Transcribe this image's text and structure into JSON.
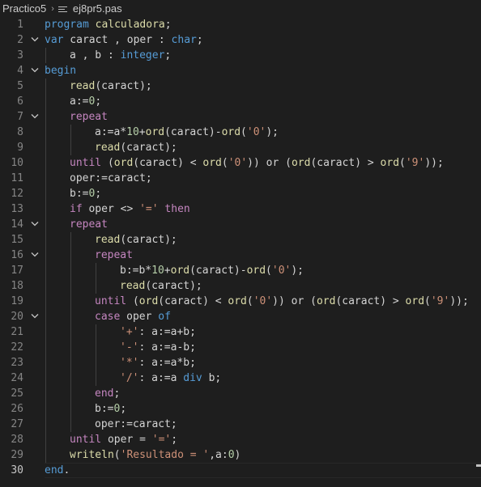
{
  "breadcrumb": {
    "folder": "Practico5",
    "separator": "›",
    "file": "ej8pr5.pas"
  },
  "editor": {
    "language": "pascal",
    "current_line": 30,
    "lines": [
      {
        "n": "1",
        "indent": 0,
        "fold": false,
        "tokens": [
          [
            "kw",
            "program"
          ],
          [
            "tx",
            " "
          ],
          [
            "fn",
            "calculadora"
          ],
          [
            "tx",
            ";"
          ]
        ]
      },
      {
        "n": "2",
        "indent": 0,
        "fold": true,
        "tokens": [
          [
            "kw",
            "var"
          ],
          [
            "tx",
            " caract , oper : "
          ],
          [
            "kw",
            "char"
          ],
          [
            "tx",
            ";"
          ]
        ]
      },
      {
        "n": "3",
        "indent": 1,
        "fold": false,
        "tokens": [
          [
            "tx",
            "a , b : "
          ],
          [
            "kw",
            "integer"
          ],
          [
            "tx",
            ";"
          ]
        ]
      },
      {
        "n": "4",
        "indent": 0,
        "fold": true,
        "tokens": [
          [
            "kw",
            "begin"
          ]
        ]
      },
      {
        "n": "5",
        "indent": 1,
        "fold": false,
        "tokens": [
          [
            "fn",
            "read"
          ],
          [
            "tx",
            "(caract);"
          ]
        ]
      },
      {
        "n": "6",
        "indent": 1,
        "fold": false,
        "tokens": [
          [
            "tx",
            "a:="
          ],
          [
            "num",
            "0"
          ],
          [
            "tx",
            ";"
          ]
        ]
      },
      {
        "n": "7",
        "indent": 1,
        "fold": true,
        "tokens": [
          [
            "ctl",
            "repeat"
          ]
        ]
      },
      {
        "n": "8",
        "indent": 2,
        "fold": false,
        "tokens": [
          [
            "tx",
            "a:=a*"
          ],
          [
            "num",
            "10"
          ],
          [
            "tx",
            "+"
          ],
          [
            "fn",
            "ord"
          ],
          [
            "tx",
            "(caract)-"
          ],
          [
            "fn",
            "ord"
          ],
          [
            "tx",
            "("
          ],
          [
            "str",
            "'0'"
          ],
          [
            "tx",
            ");"
          ]
        ]
      },
      {
        "n": "9",
        "indent": 2,
        "fold": false,
        "tokens": [
          [
            "fn",
            "read"
          ],
          [
            "tx",
            "(caract);"
          ]
        ]
      },
      {
        "n": "10",
        "indent": 1,
        "fold": false,
        "tokens": [
          [
            "ctl",
            "until"
          ],
          [
            "tx",
            " ("
          ],
          [
            "fn",
            "ord"
          ],
          [
            "tx",
            "(caract) < "
          ],
          [
            "fn",
            "ord"
          ],
          [
            "tx",
            "("
          ],
          [
            "str",
            "'0'"
          ],
          [
            "tx",
            ")) or ("
          ],
          [
            "fn",
            "ord"
          ],
          [
            "tx",
            "(caract) > "
          ],
          [
            "fn",
            "ord"
          ],
          [
            "tx",
            "("
          ],
          [
            "str",
            "'9'"
          ],
          [
            "tx",
            "));"
          ]
        ]
      },
      {
        "n": "11",
        "indent": 1,
        "fold": false,
        "tokens": [
          [
            "tx",
            "oper:=caract;"
          ]
        ]
      },
      {
        "n": "12",
        "indent": 1,
        "fold": false,
        "tokens": [
          [
            "tx",
            "b:="
          ],
          [
            "num",
            "0"
          ],
          [
            "tx",
            ";"
          ]
        ]
      },
      {
        "n": "13",
        "indent": 1,
        "fold": false,
        "tokens": [
          [
            "ctl",
            "if"
          ],
          [
            "tx",
            " oper <> "
          ],
          [
            "str",
            "'='"
          ],
          [
            "tx",
            " "
          ],
          [
            "ctl",
            "then"
          ]
        ]
      },
      {
        "n": "14",
        "indent": 1,
        "fold": true,
        "tokens": [
          [
            "ctl",
            "repeat"
          ]
        ]
      },
      {
        "n": "15",
        "indent": 2,
        "fold": false,
        "tokens": [
          [
            "fn",
            "read"
          ],
          [
            "tx",
            "(caract);"
          ]
        ]
      },
      {
        "n": "16",
        "indent": 2,
        "fold": true,
        "tokens": [
          [
            "ctl",
            "repeat"
          ]
        ]
      },
      {
        "n": "17",
        "indent": 3,
        "fold": false,
        "tokens": [
          [
            "tx",
            "b:=b*"
          ],
          [
            "num",
            "10"
          ],
          [
            "tx",
            "+"
          ],
          [
            "fn",
            "ord"
          ],
          [
            "tx",
            "(caract)-"
          ],
          [
            "fn",
            "ord"
          ],
          [
            "tx",
            "("
          ],
          [
            "str",
            "'0'"
          ],
          [
            "tx",
            ");"
          ]
        ]
      },
      {
        "n": "18",
        "indent": 3,
        "fold": false,
        "tokens": [
          [
            "fn",
            "read"
          ],
          [
            "tx",
            "(caract);"
          ]
        ]
      },
      {
        "n": "19",
        "indent": 2,
        "fold": false,
        "tokens": [
          [
            "ctl",
            "until"
          ],
          [
            "tx",
            " ("
          ],
          [
            "fn",
            "ord"
          ],
          [
            "tx",
            "(caract) < "
          ],
          [
            "fn",
            "ord"
          ],
          [
            "tx",
            "("
          ],
          [
            "str",
            "'0'"
          ],
          [
            "tx",
            ")) or ("
          ],
          [
            "fn",
            "ord"
          ],
          [
            "tx",
            "(caract) > "
          ],
          [
            "fn",
            "ord"
          ],
          [
            "tx",
            "("
          ],
          [
            "str",
            "'9'"
          ],
          [
            "tx",
            "));"
          ]
        ]
      },
      {
        "n": "20",
        "indent": 2,
        "fold": true,
        "tokens": [
          [
            "ctl",
            "case"
          ],
          [
            "tx",
            " oper "
          ],
          [
            "kw",
            "of"
          ]
        ]
      },
      {
        "n": "21",
        "indent": 3,
        "fold": false,
        "tokens": [
          [
            "str",
            "'+'"
          ],
          [
            "tx",
            ": a:=a+b;"
          ]
        ]
      },
      {
        "n": "22",
        "indent": 3,
        "fold": false,
        "tokens": [
          [
            "str",
            "'-'"
          ],
          [
            "tx",
            ": a:=a-b;"
          ]
        ]
      },
      {
        "n": "23",
        "indent": 3,
        "fold": false,
        "tokens": [
          [
            "str",
            "'*'"
          ],
          [
            "tx",
            ": a:=a*b;"
          ]
        ]
      },
      {
        "n": "24",
        "indent": 3,
        "fold": false,
        "tokens": [
          [
            "str",
            "'/'"
          ],
          [
            "tx",
            ": a:=a "
          ],
          [
            "kw",
            "div"
          ],
          [
            "tx",
            " b;"
          ]
        ]
      },
      {
        "n": "25",
        "indent": 2,
        "fold": false,
        "tokens": [
          [
            "ctl",
            "end"
          ],
          [
            "tx",
            ";"
          ]
        ]
      },
      {
        "n": "26",
        "indent": 2,
        "fold": false,
        "tokens": [
          [
            "tx",
            "b:="
          ],
          [
            "num",
            "0"
          ],
          [
            "tx",
            ";"
          ]
        ]
      },
      {
        "n": "27",
        "indent": 2,
        "fold": false,
        "tokens": [
          [
            "tx",
            "oper:=caract;"
          ]
        ]
      },
      {
        "n": "28",
        "indent": 1,
        "fold": false,
        "tokens": [
          [
            "ctl",
            "until"
          ],
          [
            "tx",
            " oper = "
          ],
          [
            "str",
            "'='"
          ],
          [
            "tx",
            ";"
          ]
        ]
      },
      {
        "n": "29",
        "indent": 1,
        "fold": false,
        "tokens": [
          [
            "fn",
            "writeln"
          ],
          [
            "tx",
            "("
          ],
          [
            "str",
            "'Resultado = '"
          ],
          [
            "tx",
            ",a:"
          ],
          [
            "num",
            "0"
          ],
          [
            "tx",
            ")"
          ]
        ]
      },
      {
        "n": "30",
        "indent": 0,
        "fold": false,
        "tokens": [
          [
            "kw",
            "end"
          ],
          [
            "tx",
            "."
          ]
        ]
      }
    ]
  }
}
